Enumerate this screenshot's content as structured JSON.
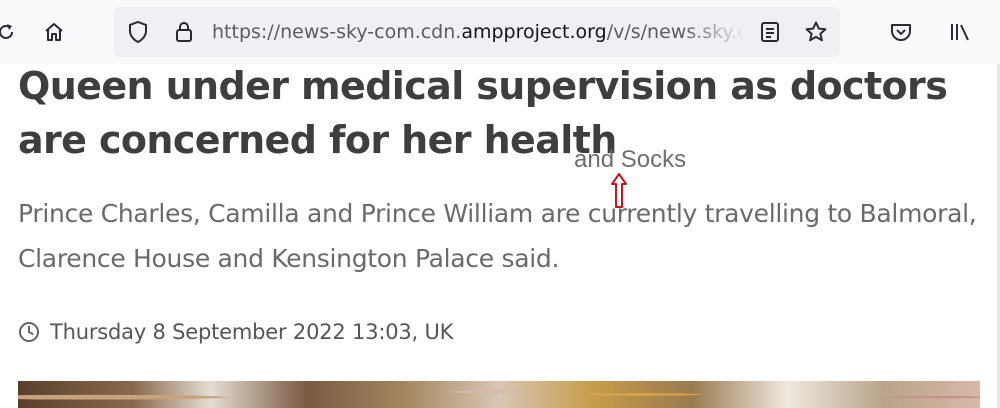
{
  "browser": {
    "url_prefix": "https://news-sky-com.cdn.",
    "url_domain": "ampproject.org",
    "url_suffix": "/v/s/news.sky.com",
    "icons": [
      "reload-icon",
      "home-icon",
      "shield-icon",
      "lock-icon",
      "reader-view-icon",
      "bookmark-star-icon",
      "pocket-icon",
      "library-icon"
    ]
  },
  "article": {
    "headline": "Queen under medical supervision as doctors are concerned for her health",
    "subheadline": "Prince Charles, Camilla and Prince William are currently travelling to Balmoral, Clarence House and Kensington Palace said.",
    "date": "Thursday 8 September 2022 13:03, UK"
  },
  "annotation": {
    "text": "and Socks",
    "arrow_color": "#c4161c"
  }
}
